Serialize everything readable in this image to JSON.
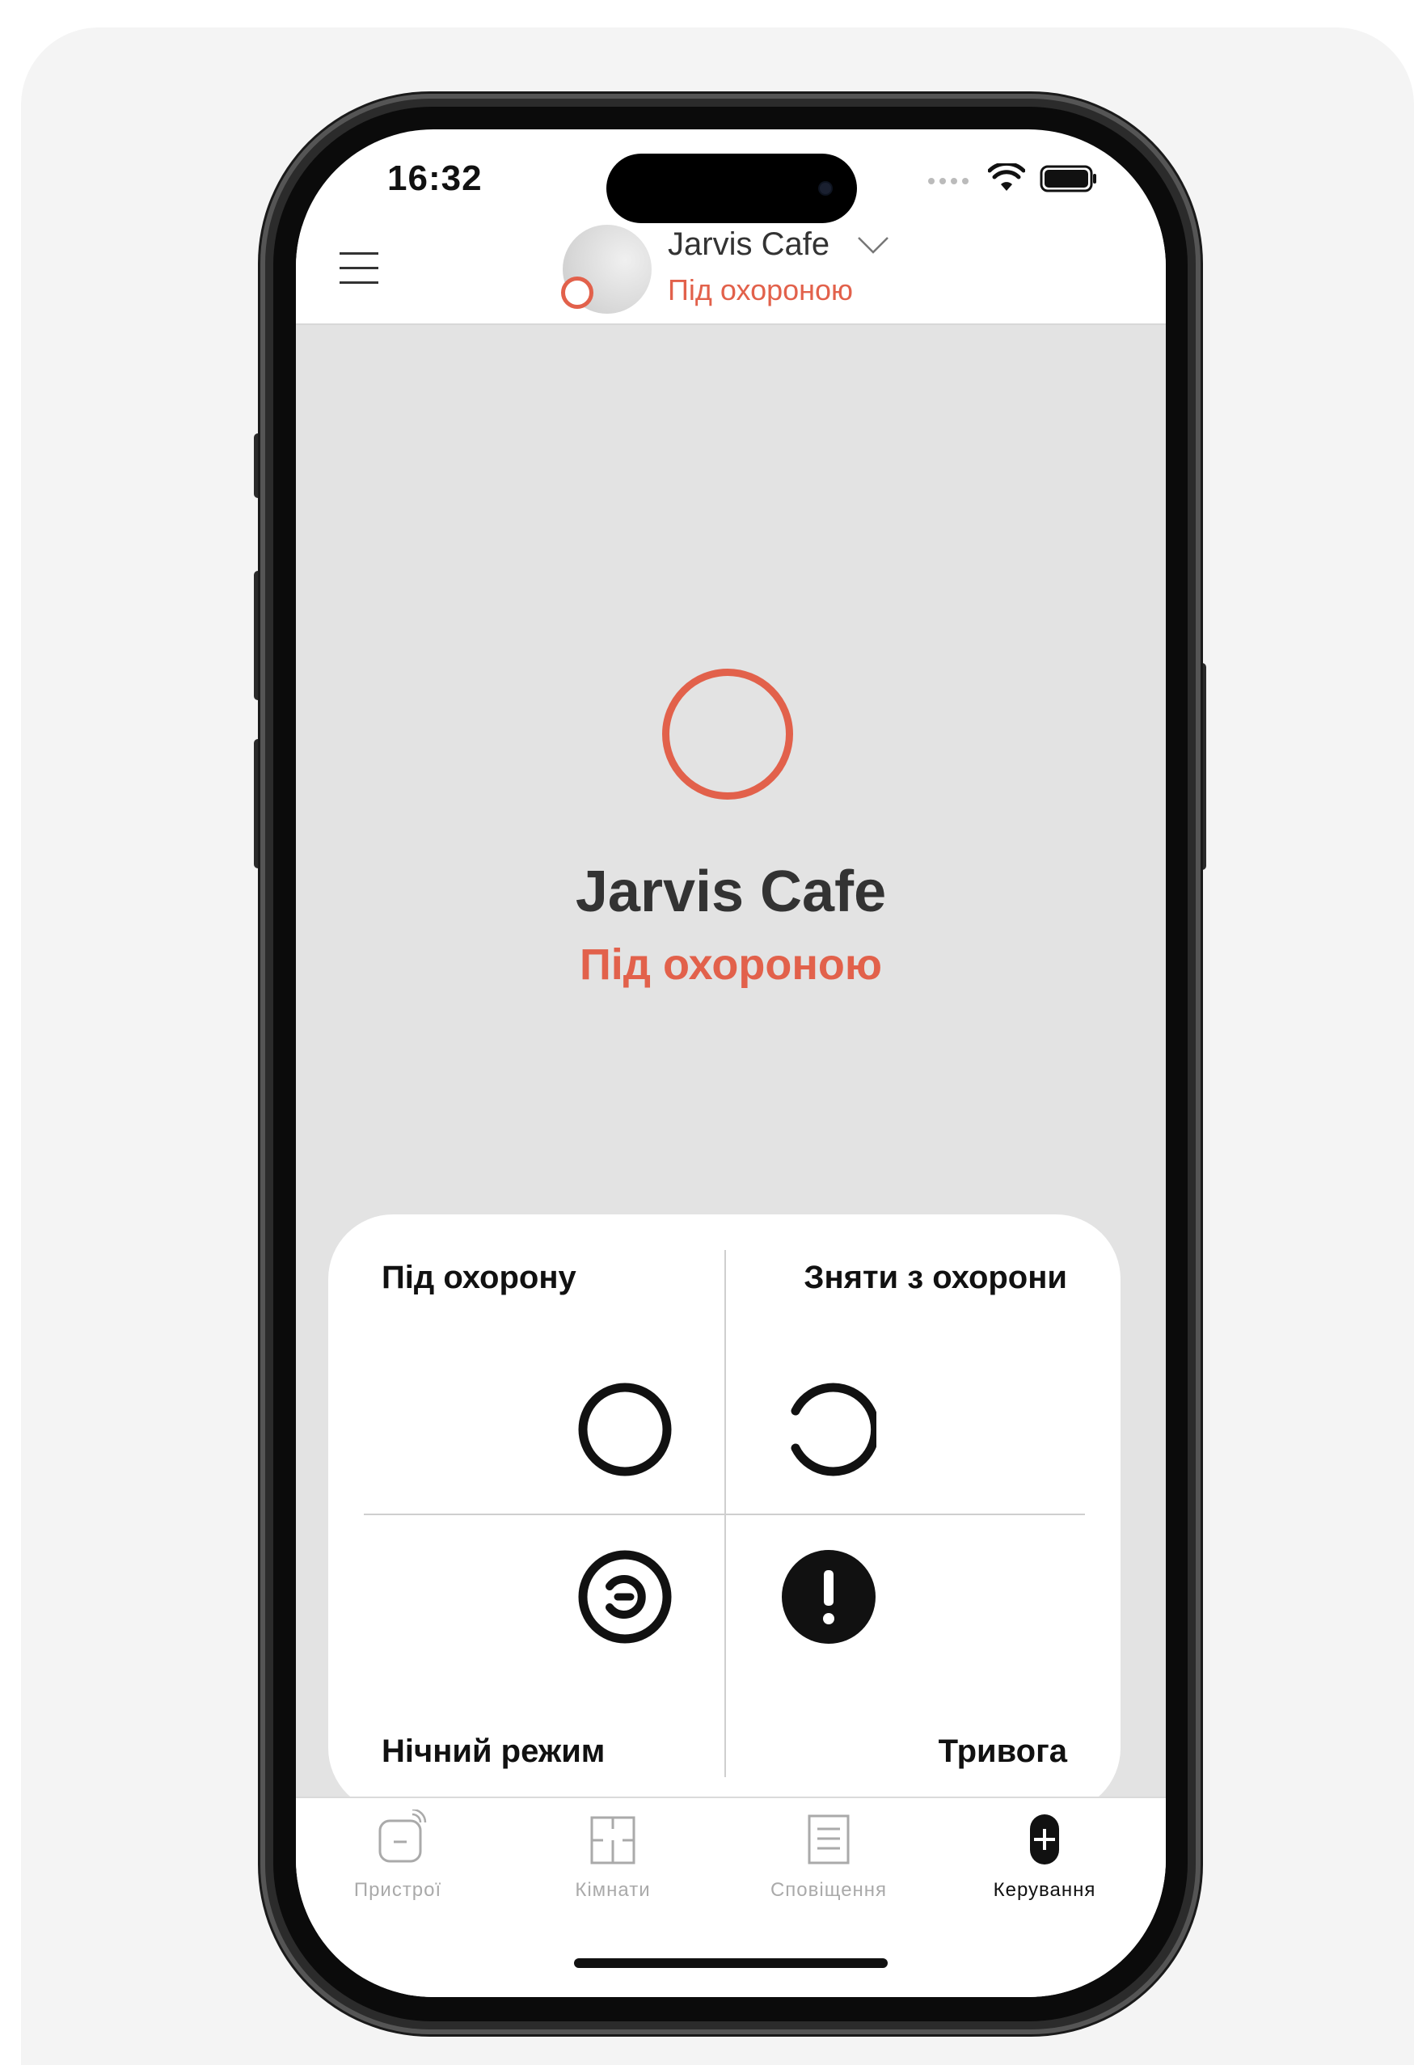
{
  "status_bar": {
    "time": "16:32"
  },
  "header": {
    "hub_name": "Jarvis Cafe",
    "hub_status": "Під охороною"
  },
  "main": {
    "hub_name": "Jarvis Cafe",
    "hub_status": "Під охороною"
  },
  "controls": {
    "arm_label": "Під охорону",
    "disarm_label": "Зняти з охорони",
    "night_mode_label": "Нічний режим",
    "panic_label": "Тривога"
  },
  "tab_bar": {
    "tabs": [
      {
        "label": "Пристрої",
        "icon": "devices-icon",
        "active": false
      },
      {
        "label": "Кімнати",
        "icon": "rooms-icon",
        "active": false
      },
      {
        "label": "Сповіщення",
        "icon": "notifications-icon",
        "active": false
      },
      {
        "label": "Керування",
        "icon": "control-icon",
        "active": true
      }
    ]
  },
  "colors": {
    "accent_armed": "#e2614b",
    "background": "#e3e3e3",
    "text_primary": "#333333",
    "tab_inactive": "#aaaaaa"
  }
}
